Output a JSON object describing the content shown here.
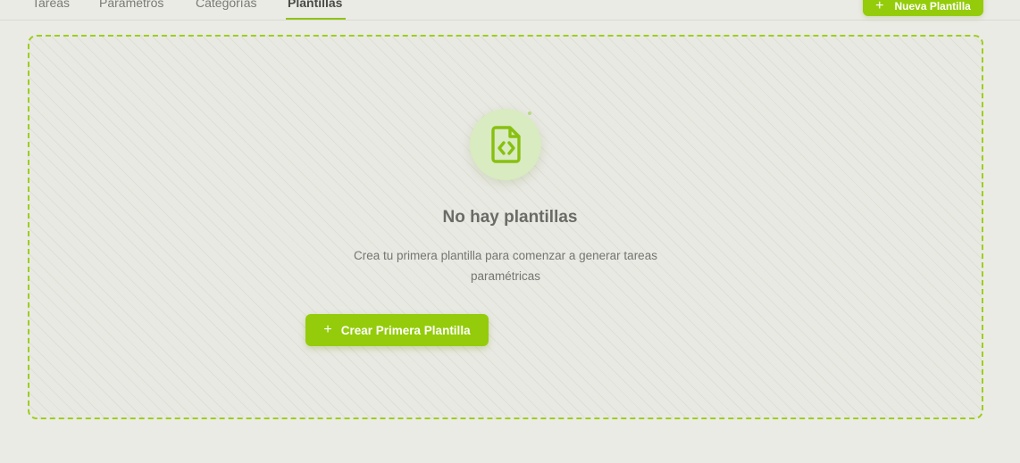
{
  "tabs": [
    {
      "label": "Tareas"
    },
    {
      "label": "Parámetros"
    },
    {
      "label": "Categorías"
    },
    {
      "label": "Plantillas",
      "active": true
    }
  ],
  "header": {
    "new_button_label": "Nueva Plantilla",
    "new_button_icon": "plus-icon"
  },
  "empty_state": {
    "icon": "file-code-icon",
    "title": "No hay plantillas",
    "description": "Crea tu primera plantilla para comenzar a generar tareas paramétricas",
    "cta_label": "Crear Primera Plantilla",
    "cta_icon": "plus-icon"
  },
  "colors": {
    "accent": "#94cc0b",
    "background": "#ebebe6",
    "icon_bg": "#d9ebc0"
  }
}
